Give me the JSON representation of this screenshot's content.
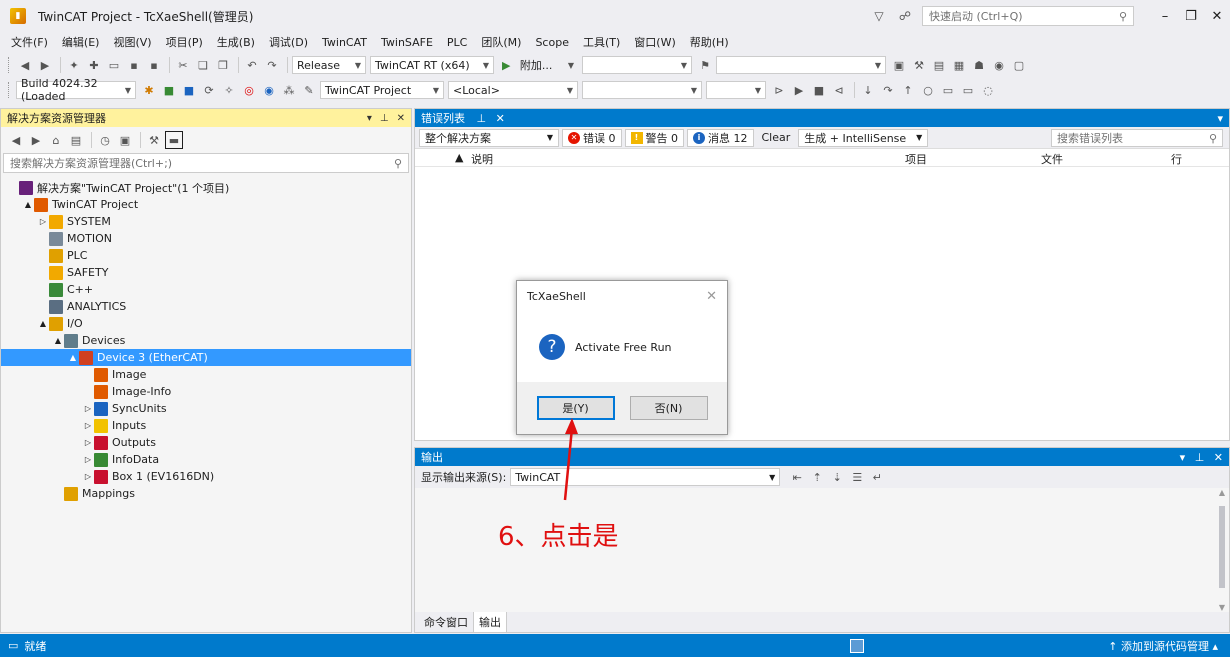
{
  "window": {
    "title": "TwinCAT Project - TcXaeShell(管理员)",
    "quick_launch_placeholder": "快速启动 (Ctrl+Q)"
  },
  "menu": [
    "文件(F)",
    "编辑(E)",
    "视图(V)",
    "项目(P)",
    "生成(B)",
    "调试(D)",
    "TwinCAT",
    "TwinSAFE",
    "PLC",
    "团队(M)",
    "Scope",
    "工具(T)",
    "窗口(W)",
    "帮助(H)"
  ],
  "toolbar1": {
    "config": "Release",
    "platform": "TwinCAT RT (x64)",
    "attach": "附加..."
  },
  "toolbar2": {
    "build": "Build 4024.32 (Loaded",
    "project": "TwinCAT Project",
    "target": "<Local>"
  },
  "solution_explorer": {
    "title": "解决方案资源管理器",
    "search_placeholder": "搜索解决方案资源管理器(Ctrl+;)",
    "nodes": [
      {
        "label": "解决方案\"TwinCAT Project\"(1 个项目)",
        "level": 0,
        "icon": "solution-icon",
        "toggle": ""
      },
      {
        "label": "TwinCAT Project",
        "level": 1,
        "icon": "twincat-project-icon",
        "toggle": "▲"
      },
      {
        "label": "SYSTEM",
        "level": 2,
        "icon": "system-icon",
        "toggle": "▷"
      },
      {
        "label": "MOTION",
        "level": 2,
        "icon": "motion-icon",
        "toggle": ""
      },
      {
        "label": "PLC",
        "level": 2,
        "icon": "plc-icon",
        "toggle": ""
      },
      {
        "label": "SAFETY",
        "level": 2,
        "icon": "safety-icon",
        "toggle": ""
      },
      {
        "label": "C++",
        "level": 2,
        "icon": "cpp-icon",
        "toggle": ""
      },
      {
        "label": "ANALYTICS",
        "level": 2,
        "icon": "analytics-icon",
        "toggle": ""
      },
      {
        "label": "I/O",
        "level": 2,
        "icon": "io-icon",
        "toggle": "▲"
      },
      {
        "label": "Devices",
        "level": 3,
        "icon": "devices-icon",
        "toggle": "▲"
      },
      {
        "label": "Device 3 (EtherCAT)",
        "level": 4,
        "icon": "ethercat-device-icon",
        "toggle": "▲",
        "selected": true
      },
      {
        "label": "Image",
        "level": 5,
        "icon": "image-icon",
        "toggle": ""
      },
      {
        "label": "Image-Info",
        "level": 5,
        "icon": "image-info-icon",
        "toggle": ""
      },
      {
        "label": "SyncUnits",
        "level": 5,
        "icon": "syncunits-icon",
        "toggle": "▷"
      },
      {
        "label": "Inputs",
        "level": 5,
        "icon": "inputs-icon",
        "toggle": "▷"
      },
      {
        "label": "Outputs",
        "level": 5,
        "icon": "outputs-icon",
        "toggle": "▷"
      },
      {
        "label": "InfoData",
        "level": 5,
        "icon": "infodata-icon",
        "toggle": "▷"
      },
      {
        "label": "Box 1 (EV1616DN)",
        "level": 5,
        "icon": "box-icon",
        "toggle": "▷"
      },
      {
        "label": "Mappings",
        "level": 3,
        "icon": "mappings-icon",
        "toggle": ""
      }
    ]
  },
  "error_list": {
    "title": "错误列表",
    "scope": "整个解决方案",
    "errors": "错误 0",
    "warnings": "警告 0",
    "messages": "消息 12",
    "clear": "Clear",
    "build_filter": "生成 + IntelliSense",
    "search_placeholder": "搜索错误列表",
    "columns": {
      "description": "说明",
      "project": "项目",
      "file": "文件",
      "line": "行"
    }
  },
  "dialog": {
    "title": "TcXaeShell",
    "message": "Activate Free Run",
    "yes": "是(Y)",
    "no": "否(N)"
  },
  "output": {
    "title": "输出",
    "source_label": "显示输出来源(S):",
    "source_value": "TwinCAT",
    "tabs": [
      "命令窗口",
      "输出"
    ]
  },
  "annotation": {
    "text": "6、点击是",
    "color": "#e01010"
  },
  "status": {
    "left": "就绪",
    "right": "添加到源代码管理"
  },
  "colors": {
    "accent": "#007acc",
    "selection": "#3399ff",
    "active_header": "#fff29d"
  }
}
